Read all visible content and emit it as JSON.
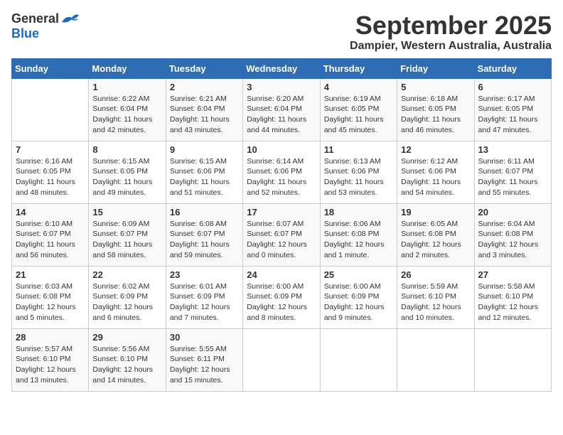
{
  "logo": {
    "text_general": "General",
    "text_blue": "Blue"
  },
  "title": "September 2025",
  "subtitle": "Dampier, Western Australia, Australia",
  "days_of_week": [
    "Sunday",
    "Monday",
    "Tuesday",
    "Wednesday",
    "Thursday",
    "Friday",
    "Saturday"
  ],
  "weeks": [
    [
      {
        "day": "",
        "info": ""
      },
      {
        "day": "1",
        "info": "Sunrise: 6:22 AM\nSunset: 6:04 PM\nDaylight: 11 hours\nand 42 minutes."
      },
      {
        "day": "2",
        "info": "Sunrise: 6:21 AM\nSunset: 6:04 PM\nDaylight: 11 hours\nand 43 minutes."
      },
      {
        "day": "3",
        "info": "Sunrise: 6:20 AM\nSunset: 6:04 PM\nDaylight: 11 hours\nand 44 minutes."
      },
      {
        "day": "4",
        "info": "Sunrise: 6:19 AM\nSunset: 6:05 PM\nDaylight: 11 hours\nand 45 minutes."
      },
      {
        "day": "5",
        "info": "Sunrise: 6:18 AM\nSunset: 6:05 PM\nDaylight: 11 hours\nand 46 minutes."
      },
      {
        "day": "6",
        "info": "Sunrise: 6:17 AM\nSunset: 6:05 PM\nDaylight: 11 hours\nand 47 minutes."
      }
    ],
    [
      {
        "day": "7",
        "info": "Sunrise: 6:16 AM\nSunset: 6:05 PM\nDaylight: 11 hours\nand 48 minutes."
      },
      {
        "day": "8",
        "info": "Sunrise: 6:15 AM\nSunset: 6:05 PM\nDaylight: 11 hours\nand 49 minutes."
      },
      {
        "day": "9",
        "info": "Sunrise: 6:15 AM\nSunset: 6:06 PM\nDaylight: 11 hours\nand 51 minutes."
      },
      {
        "day": "10",
        "info": "Sunrise: 6:14 AM\nSunset: 6:06 PM\nDaylight: 11 hours\nand 52 minutes."
      },
      {
        "day": "11",
        "info": "Sunrise: 6:13 AM\nSunset: 6:06 PM\nDaylight: 11 hours\nand 53 minutes."
      },
      {
        "day": "12",
        "info": "Sunrise: 6:12 AM\nSunset: 6:06 PM\nDaylight: 11 hours\nand 54 minutes."
      },
      {
        "day": "13",
        "info": "Sunrise: 6:11 AM\nSunset: 6:07 PM\nDaylight: 11 hours\nand 55 minutes."
      }
    ],
    [
      {
        "day": "14",
        "info": "Sunrise: 6:10 AM\nSunset: 6:07 PM\nDaylight: 11 hours\nand 56 minutes."
      },
      {
        "day": "15",
        "info": "Sunrise: 6:09 AM\nSunset: 6:07 PM\nDaylight: 11 hours\nand 58 minutes."
      },
      {
        "day": "16",
        "info": "Sunrise: 6:08 AM\nSunset: 6:07 PM\nDaylight: 11 hours\nand 59 minutes."
      },
      {
        "day": "17",
        "info": "Sunrise: 6:07 AM\nSunset: 6:07 PM\nDaylight: 12 hours\nand 0 minutes."
      },
      {
        "day": "18",
        "info": "Sunrise: 6:06 AM\nSunset: 6:08 PM\nDaylight: 12 hours\nand 1 minute."
      },
      {
        "day": "19",
        "info": "Sunrise: 6:05 AM\nSunset: 6:08 PM\nDaylight: 12 hours\nand 2 minutes."
      },
      {
        "day": "20",
        "info": "Sunrise: 6:04 AM\nSunset: 6:08 PM\nDaylight: 12 hours\nand 3 minutes."
      }
    ],
    [
      {
        "day": "21",
        "info": "Sunrise: 6:03 AM\nSunset: 6:08 PM\nDaylight: 12 hours\nand 5 minutes."
      },
      {
        "day": "22",
        "info": "Sunrise: 6:02 AM\nSunset: 6:09 PM\nDaylight: 12 hours\nand 6 minutes."
      },
      {
        "day": "23",
        "info": "Sunrise: 6:01 AM\nSunset: 6:09 PM\nDaylight: 12 hours\nand 7 minutes."
      },
      {
        "day": "24",
        "info": "Sunrise: 6:00 AM\nSunset: 6:09 PM\nDaylight: 12 hours\nand 8 minutes."
      },
      {
        "day": "25",
        "info": "Sunrise: 6:00 AM\nSunset: 6:09 PM\nDaylight: 12 hours\nand 9 minutes."
      },
      {
        "day": "26",
        "info": "Sunrise: 5:59 AM\nSunset: 6:10 PM\nDaylight: 12 hours\nand 10 minutes."
      },
      {
        "day": "27",
        "info": "Sunrise: 5:58 AM\nSunset: 6:10 PM\nDaylight: 12 hours\nand 12 minutes."
      }
    ],
    [
      {
        "day": "28",
        "info": "Sunrise: 5:57 AM\nSunset: 6:10 PM\nDaylight: 12 hours\nand 13 minutes."
      },
      {
        "day": "29",
        "info": "Sunrise: 5:56 AM\nSunset: 6:10 PM\nDaylight: 12 hours\nand 14 minutes."
      },
      {
        "day": "30",
        "info": "Sunrise: 5:55 AM\nSunset: 6:11 PM\nDaylight: 12 hours\nand 15 minutes."
      },
      {
        "day": "",
        "info": ""
      },
      {
        "day": "",
        "info": ""
      },
      {
        "day": "",
        "info": ""
      },
      {
        "day": "",
        "info": ""
      }
    ]
  ]
}
